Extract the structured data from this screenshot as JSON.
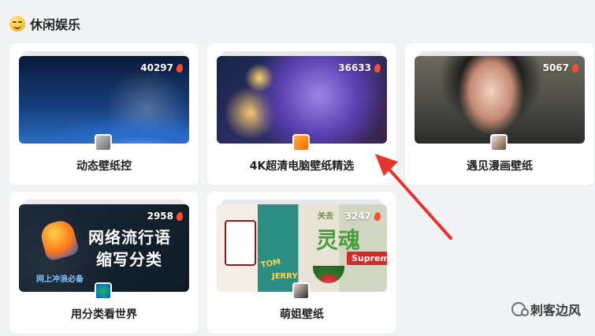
{
  "section": {
    "title": "休闲娱乐",
    "emoji_icon": "smiling-face-icon"
  },
  "cards": [
    {
      "title": "动态壁纸控",
      "count": "40297",
      "count_icon": "flame-icon",
      "cover": "earth-space-cover"
    },
    {
      "title": "4K超清电脑壁纸精选",
      "count": "36633",
      "count_icon": "flame-icon",
      "cover": "anime-girls-cover"
    },
    {
      "title": "遇见漫画壁纸",
      "count": "5067",
      "count_icon": "flame-icon",
      "cover": "comic-woman-cover"
    },
    {
      "title": "用分类看世界",
      "count": "2958",
      "count_icon": "flame-icon",
      "cover": "internet-slang-cover",
      "cover_text": {
        "line1": "网络流行语",
        "line2": "缩写分类",
        "badge": "网上冲浪必备"
      }
    },
    {
      "title": "萌姐壁纸",
      "count": "3247",
      "count_icon": "flame-icon",
      "cover": "collage-cover",
      "cover_text": {
        "tom": "TOM",
        "jerry": "JERRY",
        "sub": "关去",
        "hanzi": "灵魂",
        "supreme": "Supreme"
      }
    }
  ],
  "annotation": {
    "arrow_color": "#e8322c",
    "arrow_icon": "red-arrow-pointer"
  },
  "watermark": {
    "text": "刺客边风",
    "icon": "wechat-icon"
  },
  "colors": {
    "background": "#f2f3f5",
    "card": "#ffffff",
    "text": "#1f1f1f",
    "flame": "#ff4d2e"
  }
}
